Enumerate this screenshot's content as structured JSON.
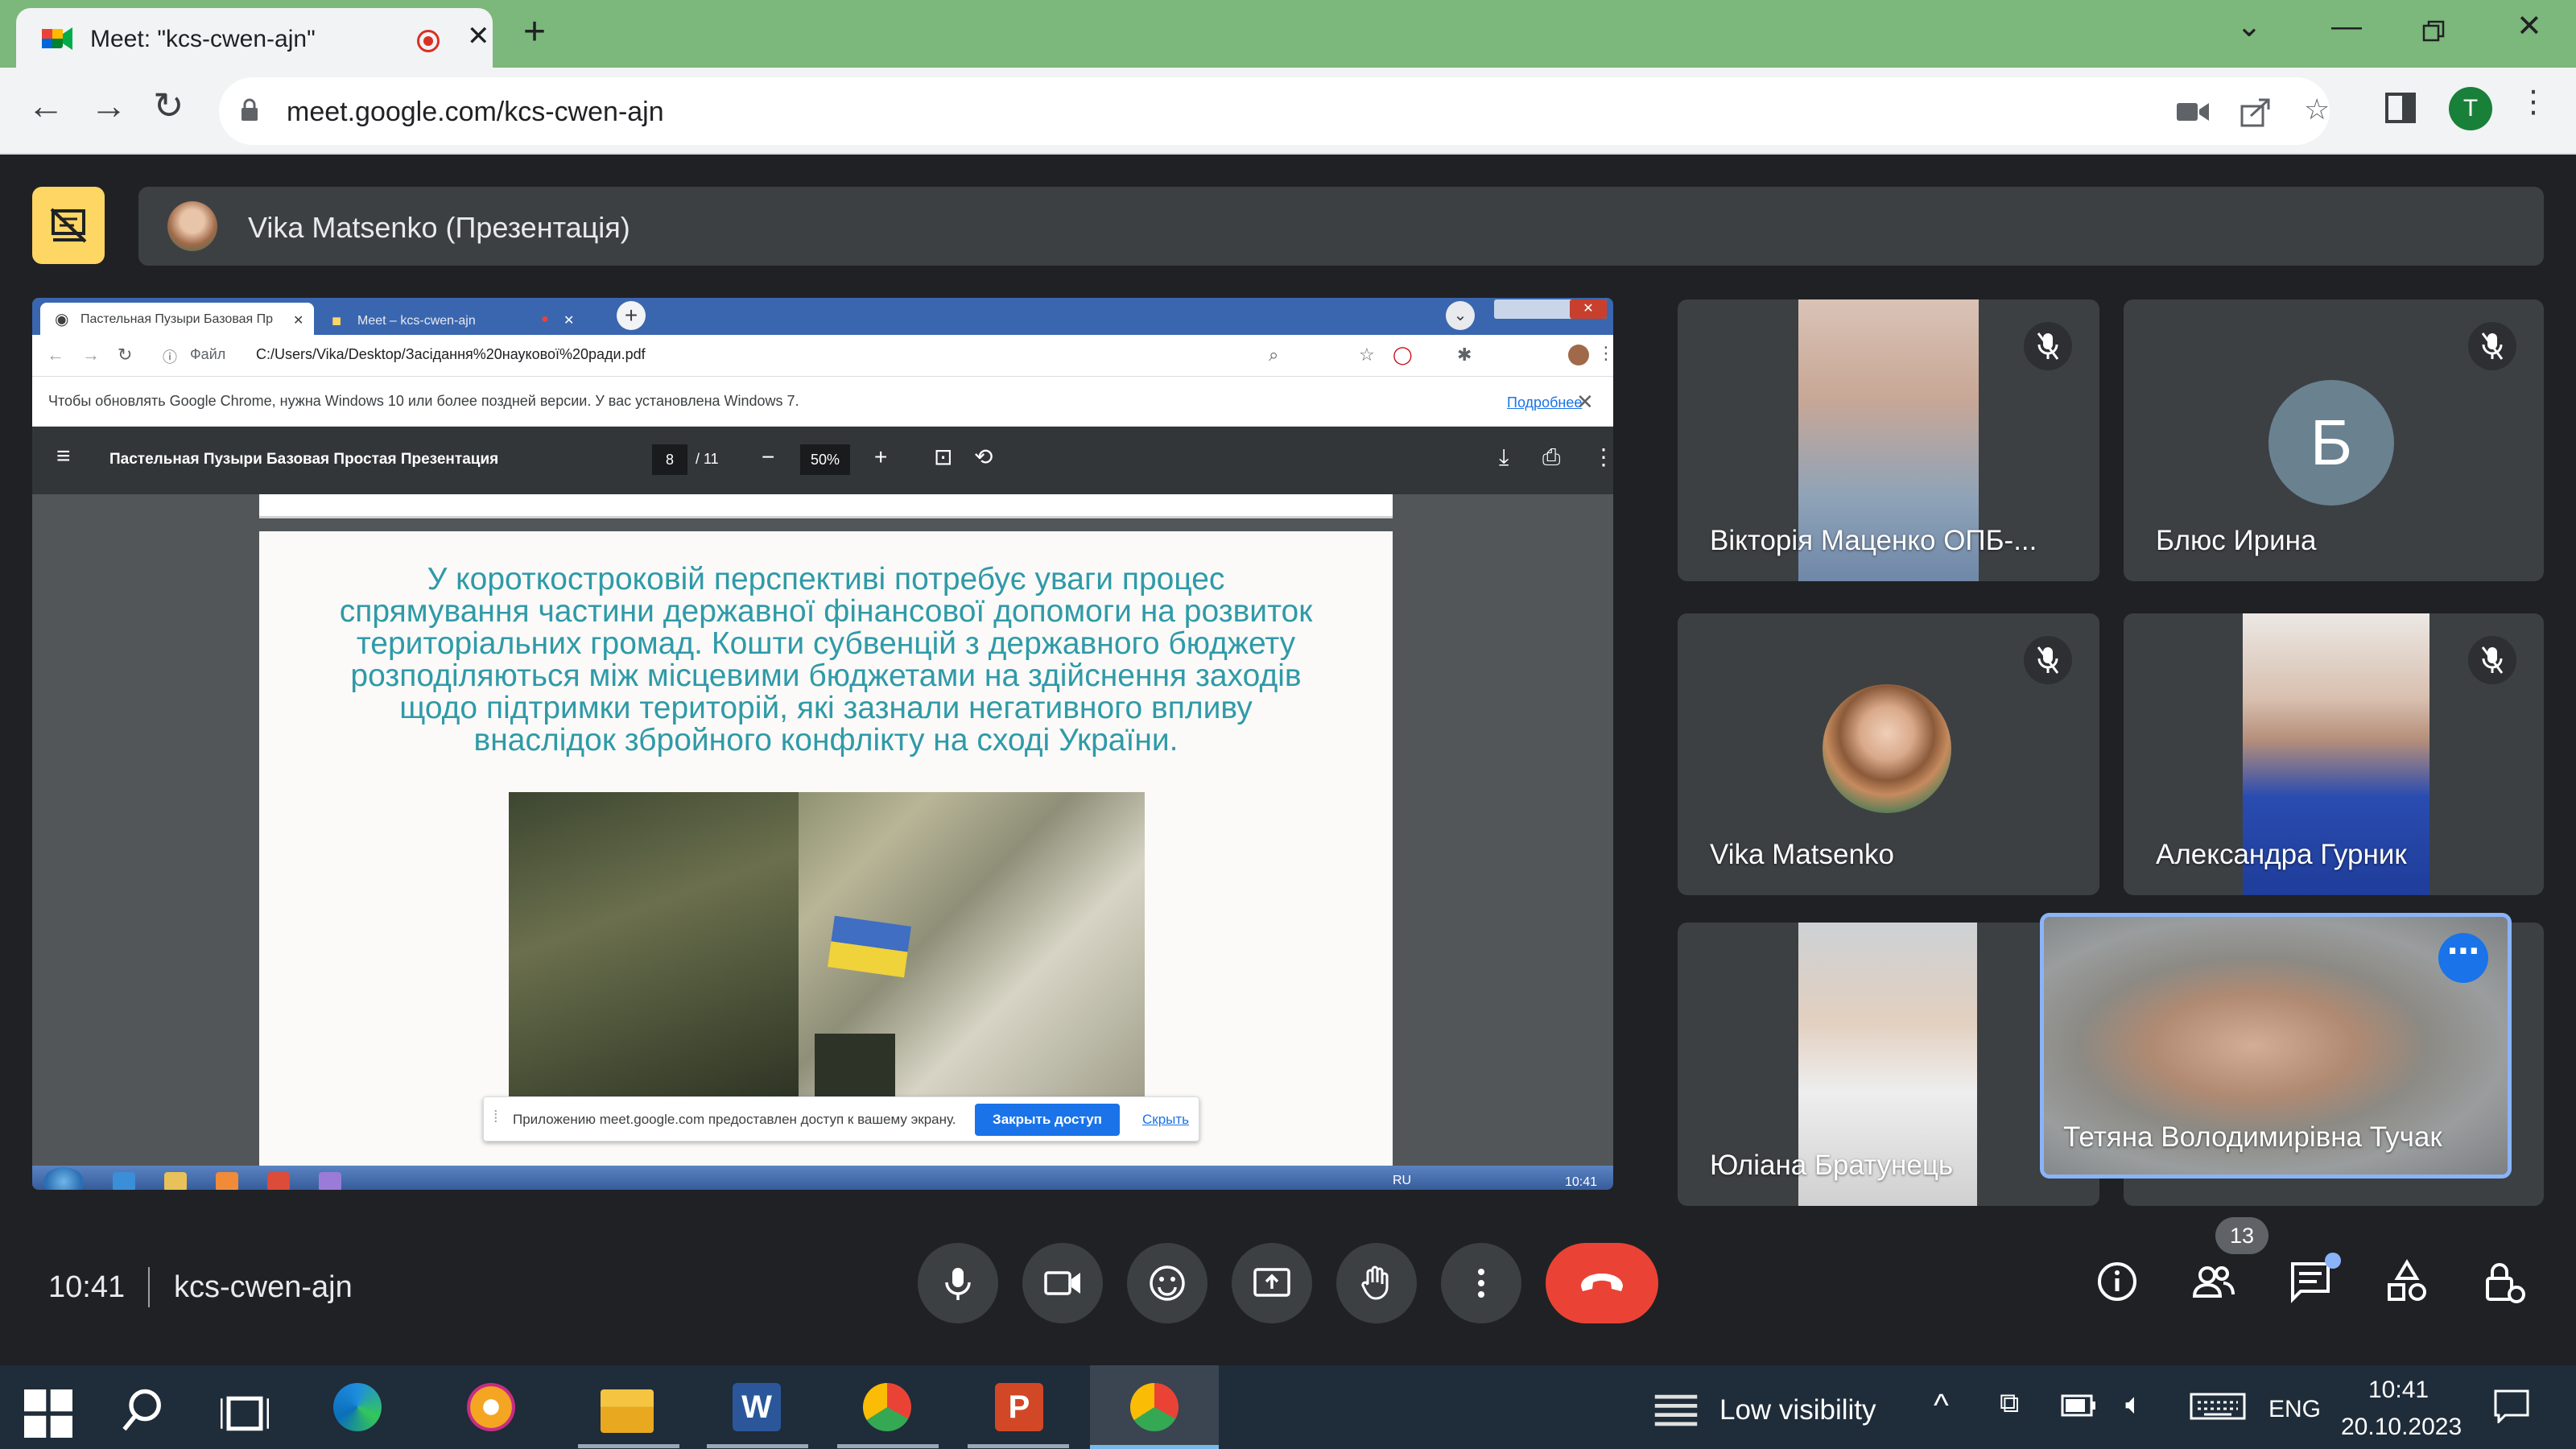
{
  "browser": {
    "tab_title": "Meet: \"kcs-cwen-ajn\"",
    "url": "meet.google.com/kcs-cwen-ajn",
    "profile_initial": "T"
  },
  "meet": {
    "presenter_label": "Vika Matsenko (Презентація)",
    "time": "10:41",
    "meeting_code": "kcs-cwen-ajn",
    "participants_count": "13",
    "participants": [
      {
        "name": "Вікторія Маценко ОПБ-..."
      },
      {
        "name": "Блюс Ирина",
        "initial": "Б"
      },
      {
        "name": "Vika Matsenko"
      },
      {
        "name": "Александра Гурник"
      },
      {
        "name": "Юліана Братунець"
      },
      {
        "name": "Тетяна Володимирівна Тучак"
      }
    ],
    "more_options": "⋯"
  },
  "shared_screen": {
    "tab1_title": "Пастельная Пузыри Базовая Пр",
    "tab2_title": "Meet – kcs-cwen-ajn",
    "file_label": "Файл",
    "path": "C:/Users/Vika/Desktop/Засідання%20наукової%20ради.pdf",
    "info_text": "Чтобы обновлять Google Chrome, нужна Windows 10 или более поздней версии. У вас установлена Windows 7.",
    "info_link": "Подробнее",
    "pdf_title": "Пастельная Пузыри Базовая Простая Презентация",
    "page_current": "8",
    "page_total": "/ 11",
    "zoom": "50%",
    "slide_lines": [
      "У короткостроковій перспективі потребує уваги процес",
      "спрямування частини державної фінансової допомоги на розвиток",
      "територіальних громад. Кошти субвенцій з державного бюджету",
      "розподіляються між місцевими бюджетами на здійснення заходів",
      "щодо підтримки територій, які зазнали негативного впливу",
      "внаслідок збройного конфлікту на сході України."
    ],
    "share_text": "Приложению meet.google.com предоставлен доступ к вашему экрану.",
    "share_button": "Закрыть доступ",
    "share_hide": "Скрыть",
    "tray_lang": "RU",
    "tray_time": "10:41"
  },
  "taskbar": {
    "weather": "Low visibility",
    "lang": "ENG",
    "time": "10:41",
    "date": "20.10.2023"
  },
  "colors": {
    "tab_strip": "#7cb77c",
    "meet_bg": "#202124",
    "tile_bg": "#3c4043",
    "hangup": "#ea4335",
    "present_yellow": "#fdd663",
    "highlight_blue": "#1a73e8"
  }
}
